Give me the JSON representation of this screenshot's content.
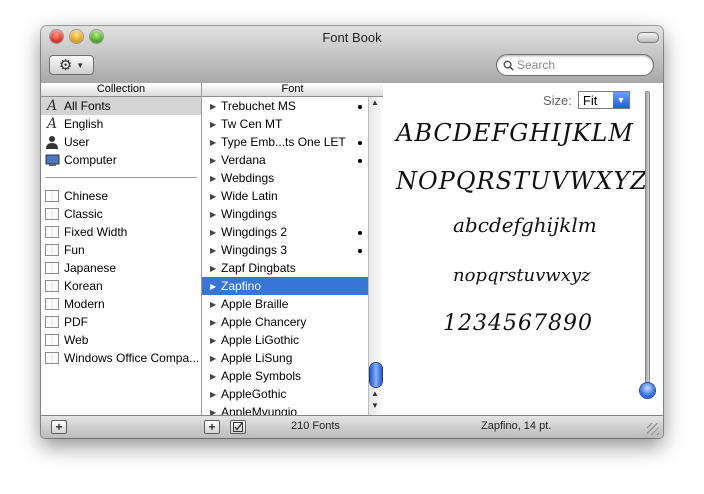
{
  "window": {
    "title": "Font Book"
  },
  "toolbar": {
    "action_icon": "gear-icon",
    "search_placeholder": "Search"
  },
  "collection": {
    "header": "Collection",
    "top_items": [
      {
        "label": "All Fonts",
        "icon": "font-letter-icon",
        "selected": true
      },
      {
        "label": "English",
        "icon": "font-letter-icon"
      },
      {
        "label": "User",
        "icon": "user-icon"
      },
      {
        "label": "Computer",
        "icon": "computer-icon"
      }
    ],
    "items": [
      {
        "label": "Chinese"
      },
      {
        "label": "Classic"
      },
      {
        "label": "Fixed Width"
      },
      {
        "label": "Fun"
      },
      {
        "label": "Japanese"
      },
      {
        "label": "Korean"
      },
      {
        "label": "Modern"
      },
      {
        "label": "PDF"
      },
      {
        "label": "Web"
      },
      {
        "label": "Windows Office Compa..."
      }
    ]
  },
  "font": {
    "header": "Font",
    "items": [
      {
        "label": "Trebuchet MS",
        "dot": true
      },
      {
        "label": "Tw Cen MT",
        "dot": false
      },
      {
        "label": "Type Emb...ts One LET",
        "dot": true
      },
      {
        "label": "Verdana",
        "dot": true
      },
      {
        "label": "Webdings",
        "dot": false
      },
      {
        "label": "Wide Latin",
        "dot": false
      },
      {
        "label": "Wingdings",
        "dot": false
      },
      {
        "label": "Wingdings 2",
        "dot": true
      },
      {
        "label": "Wingdings 3",
        "dot": true
      },
      {
        "label": "Zapf Dingbats",
        "dot": false
      },
      {
        "label": "Zapfino",
        "dot": false,
        "selected": true
      },
      {
        "label": "Apple Braille",
        "dot": false
      },
      {
        "label": "Apple Chancery",
        "dot": false
      },
      {
        "label": "Apple LiGothic",
        "dot": false
      },
      {
        "label": "Apple LiSung",
        "dot": false
      },
      {
        "label": "Apple Symbols",
        "dot": false
      },
      {
        "label": "AppleGothic",
        "dot": false
      },
      {
        "label": "AppleMyungjo",
        "dot": false
      }
    ]
  },
  "preview": {
    "size_label": "Size:",
    "size_value": "Fit",
    "line1": "ABCDEFGHIJKLM",
    "line2": "NOPQRSTUVWXYZ",
    "line3": "abcdefghijklm",
    "line4": "nopqrstuvwxyz",
    "line5": "1234567890"
  },
  "status": {
    "font_count": "210 Fonts",
    "font_info": "Zapfino, 14 pt."
  }
}
